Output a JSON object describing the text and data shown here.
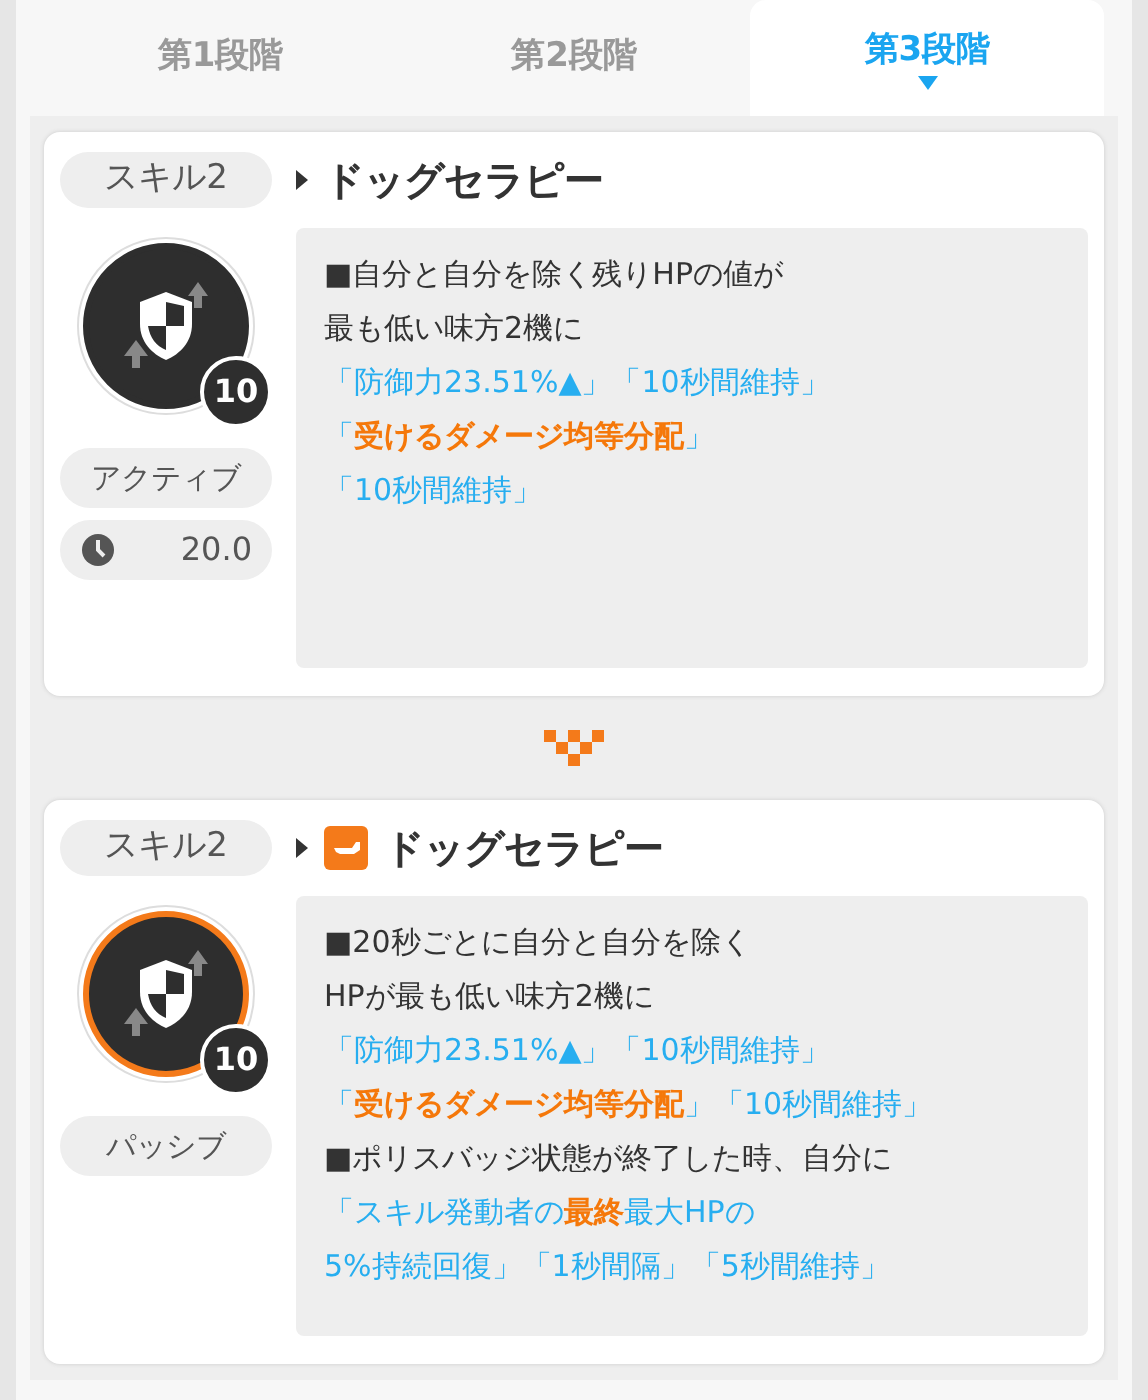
{
  "tabs": [
    {
      "label": "第1段階",
      "selected": false
    },
    {
      "label": "第2段階",
      "selected": false
    },
    {
      "label": "第3段階",
      "selected": true
    }
  ],
  "cards": [
    {
      "kind": "active",
      "skill_label": "スキル2",
      "name": "ドッグセラピー",
      "name_icon": false,
      "level": "10",
      "type_label": "アクティブ",
      "cooldown": "20.0",
      "lines": [
        [
          {
            "kind": "plain",
            "text": "■自分と自分を除く残りHPの値が"
          }
        ],
        [
          {
            "kind": "plain",
            "text": "最も低い味方2機に"
          }
        ],
        [
          {
            "kind": "blue",
            "text": "「防御力23.51%▲」「10秒間維持」"
          }
        ],
        [
          {
            "kind": "blue",
            "text": "「"
          },
          {
            "kind": "orange",
            "text": "受けるダメージ均等分配"
          },
          {
            "kind": "blue",
            "text": "」"
          }
        ],
        [
          {
            "kind": "blue",
            "text": "「10秒間維持」"
          }
        ]
      ]
    },
    {
      "kind": "passive",
      "skill_label": "スキル2",
      "name": "ドッグセラピー",
      "name_icon": true,
      "level": "10",
      "type_label": "パッシブ",
      "lines": [
        [
          {
            "kind": "plain",
            "text": "■20秒ごとに自分と自分を除く"
          }
        ],
        [
          {
            "kind": "plain",
            "text": "HPが最も低い味方2機に"
          }
        ],
        [
          {
            "kind": "blue",
            "text": "「防御力23.51%▲」「10秒間維持」"
          }
        ],
        [
          {
            "kind": "blue",
            "text": "「"
          },
          {
            "kind": "orange",
            "text": "受けるダメージ均等分配"
          },
          {
            "kind": "blue",
            "text": "」「10秒間維持」"
          }
        ],
        [
          {
            "kind": "plain",
            "text": "■ポリスバッジ状態が終了した時、自分に"
          }
        ],
        [
          {
            "kind": "blue",
            "text": "「スキル発動者の"
          },
          {
            "kind": "orange",
            "text": "最終"
          },
          {
            "kind": "blue",
            "text": "最大HPの"
          }
        ],
        [
          {
            "kind": "blue",
            "text": "5%持続回復」「1秒間隔」「5秒間維持」"
          }
        ]
      ]
    }
  ]
}
